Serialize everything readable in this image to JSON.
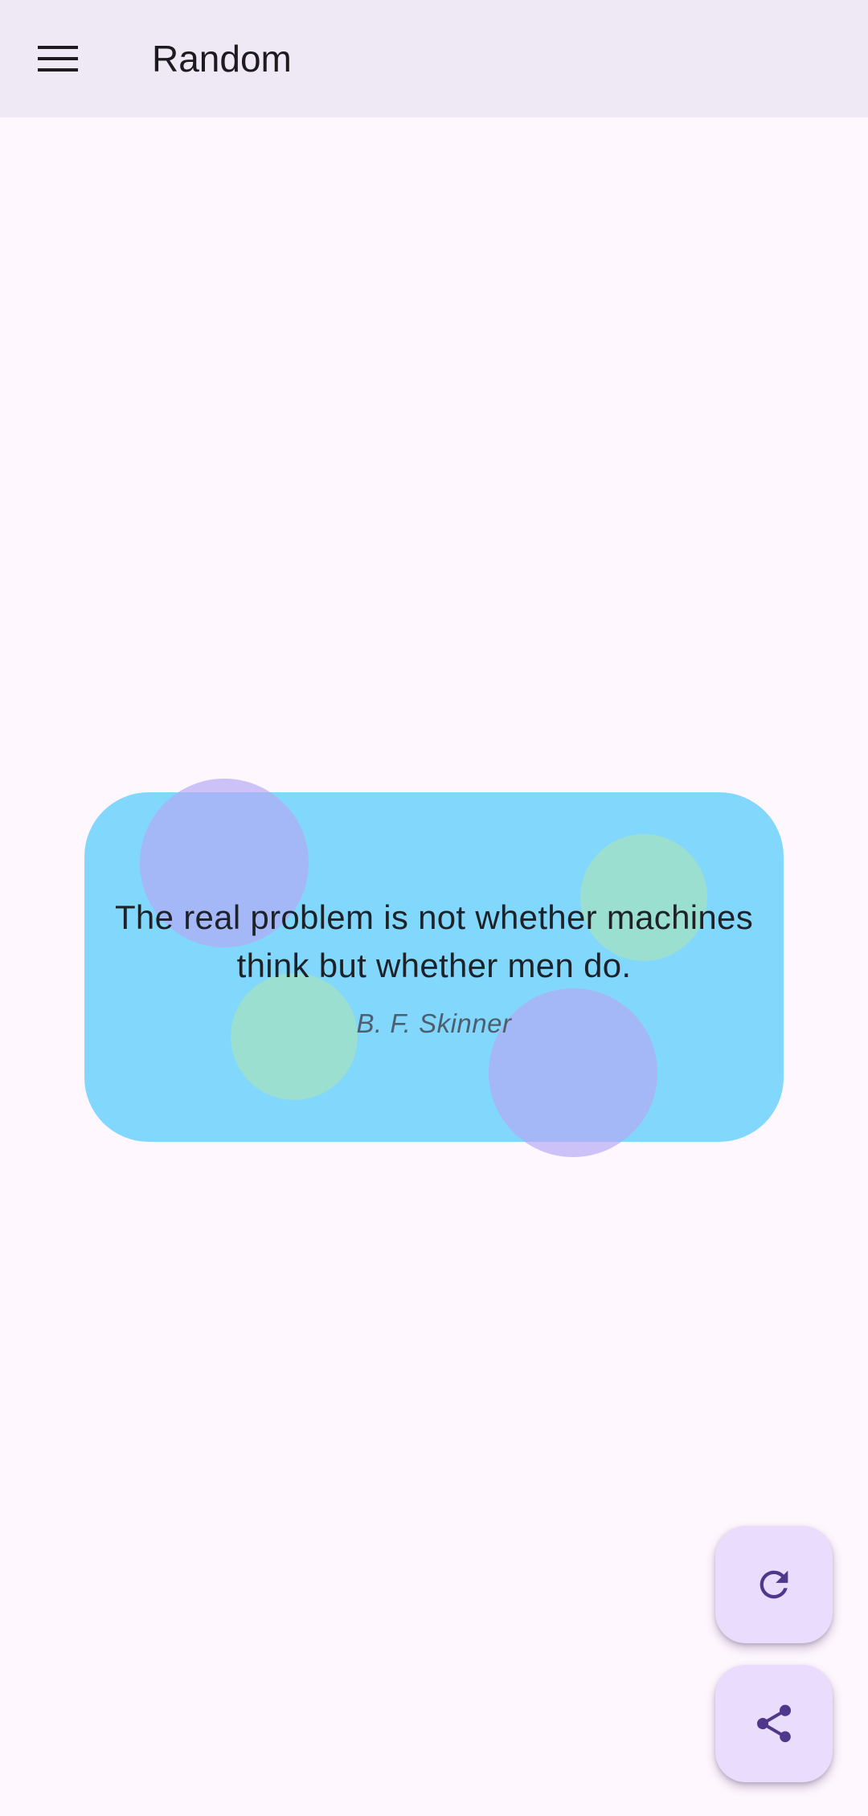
{
  "app_bar": {
    "menu_icon": "menu-icon",
    "title": "Random"
  },
  "quote": {
    "text": "The real problem is not whether machines think but whether men do.",
    "author": "B. F. Skinner"
  },
  "fabs": {
    "refresh_icon": "refresh-icon",
    "share_icon": "share-icon"
  },
  "colors": {
    "background": "#fff7fe",
    "app_bar": "#efe9f6",
    "card": "#82d7fc",
    "fab": "#eadcfc",
    "fab_icon": "#4f378b"
  }
}
